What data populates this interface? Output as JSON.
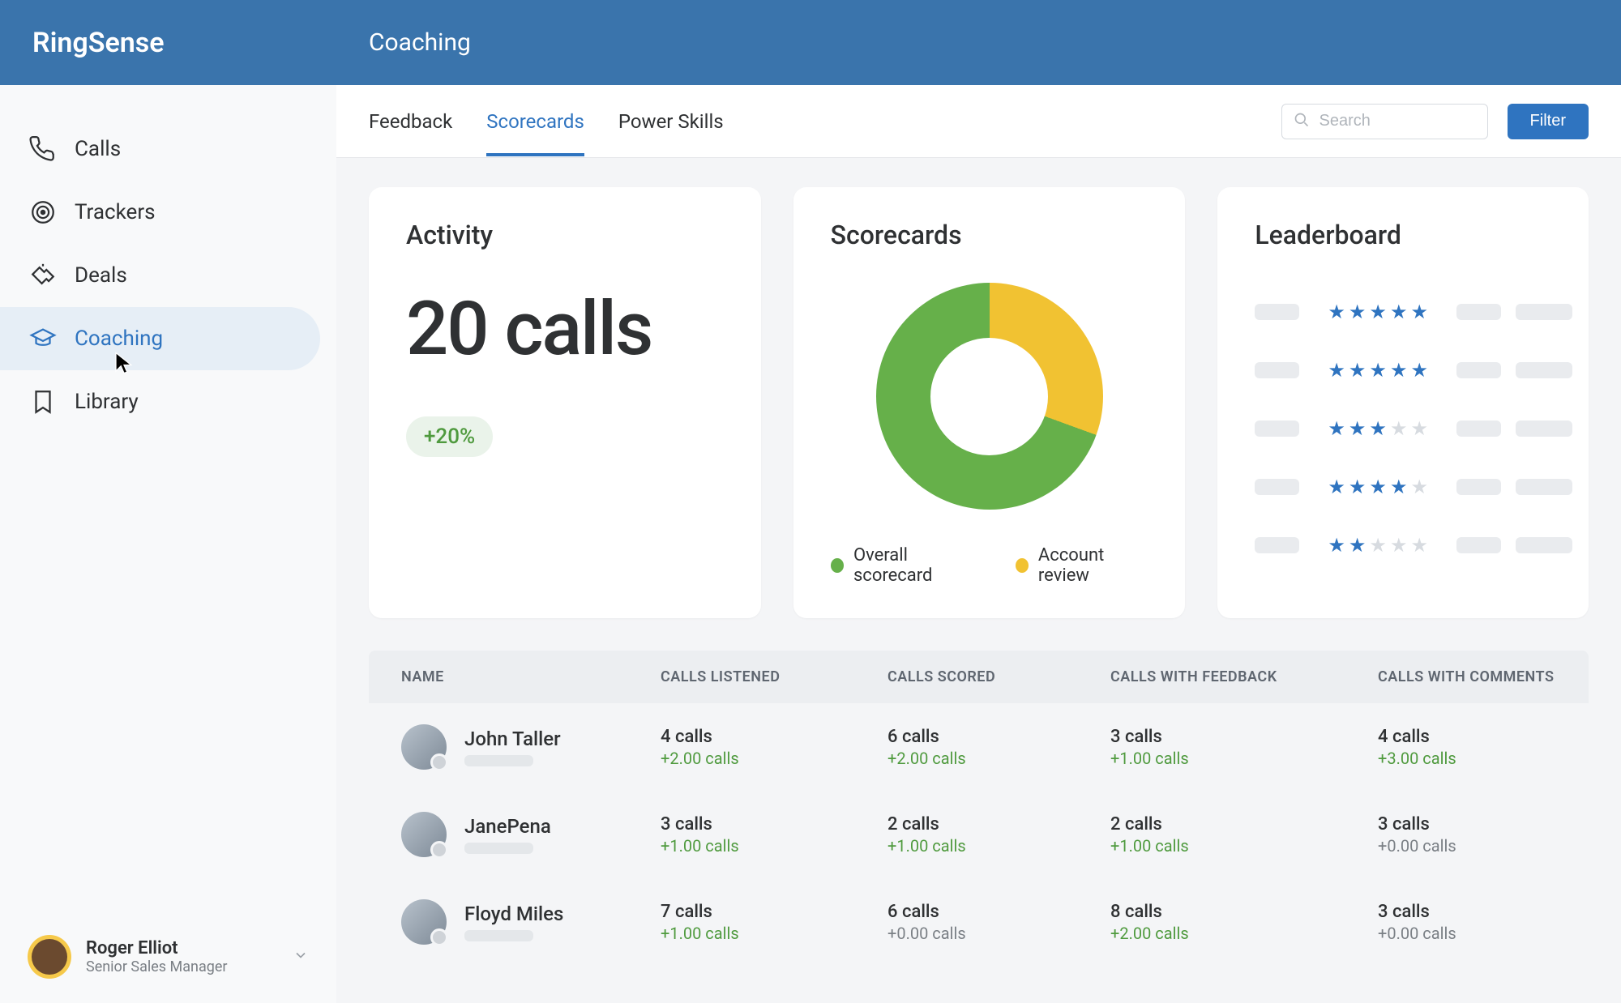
{
  "app_name": "RingSense",
  "page_title": "Coaching",
  "sidebar": {
    "items": [
      {
        "label": "Calls",
        "icon": "phone-icon"
      },
      {
        "label": "Trackers",
        "icon": "target-icon"
      },
      {
        "label": "Deals",
        "icon": "handshake-icon"
      },
      {
        "label": "Coaching",
        "icon": "graduation-icon"
      },
      {
        "label": "Library",
        "icon": "bookmark-icon"
      }
    ],
    "active_index": 3
  },
  "user": {
    "name": "Roger Elliot",
    "role": "Senior Sales Manager"
  },
  "tabs": {
    "items": [
      "Feedback",
      "Scorecards",
      "Power Skills"
    ],
    "active_index": 1
  },
  "search": {
    "placeholder": "Search"
  },
  "filter_label": "Filter",
  "cards": {
    "activity": {
      "title": "Activity",
      "value": "20 calls",
      "delta": "+20%"
    },
    "scorecards": {
      "title": "Scorecards",
      "legend": [
        {
          "label": "Overall scorecard",
          "color": "#66b04a"
        },
        {
          "label": "Account review",
          "color": "#f1c232"
        }
      ]
    },
    "leaderboard": {
      "title": "Leaderboard",
      "rows": [
        {
          "stars": 5
        },
        {
          "stars": 5
        },
        {
          "stars": 3
        },
        {
          "stars": 4
        },
        {
          "stars": 2
        }
      ]
    }
  },
  "chart_data": {
    "type": "pie",
    "title": "Scorecards",
    "series": [
      {
        "name": "Overall scorecard",
        "value": 70,
        "color": "#66b04a"
      },
      {
        "name": "Account review",
        "value": 30,
        "color": "#f1c232"
      }
    ]
  },
  "table": {
    "columns": [
      "NAME",
      "CALLS LISTENED",
      "CALLS SCORED",
      "CALLS WITH FEEDBACK",
      "CALLS WITH COMMENTS"
    ],
    "rows": [
      {
        "name": "John Taller",
        "listened": {
          "value": "4 calls",
          "delta": "+2.00 calls"
        },
        "scored": {
          "value": "6 calls",
          "delta": "+2.00 calls"
        },
        "feedback": {
          "value": "3 calls",
          "delta": "+1.00 calls"
        },
        "comments": {
          "value": "4 calls",
          "delta": "+3.00 calls"
        }
      },
      {
        "name": "JanePena",
        "listened": {
          "value": "3 calls",
          "delta": "+1.00 calls"
        },
        "scored": {
          "value": "2 calls",
          "delta": "+1.00 calls"
        },
        "feedback": {
          "value": "2 calls",
          "delta": "+1.00 calls"
        },
        "comments": {
          "value": "3 calls",
          "delta": "+0.00 calls"
        }
      },
      {
        "name": "Floyd Miles",
        "listened": {
          "value": "7 calls",
          "delta": "+1.00 calls"
        },
        "scored": {
          "value": "6 calls",
          "delta": "+0.00 calls"
        },
        "feedback": {
          "value": "8 calls",
          "delta": "+2.00 calls"
        },
        "comments": {
          "value": "3 calls",
          "delta": "+0.00 calls"
        }
      }
    ]
  }
}
